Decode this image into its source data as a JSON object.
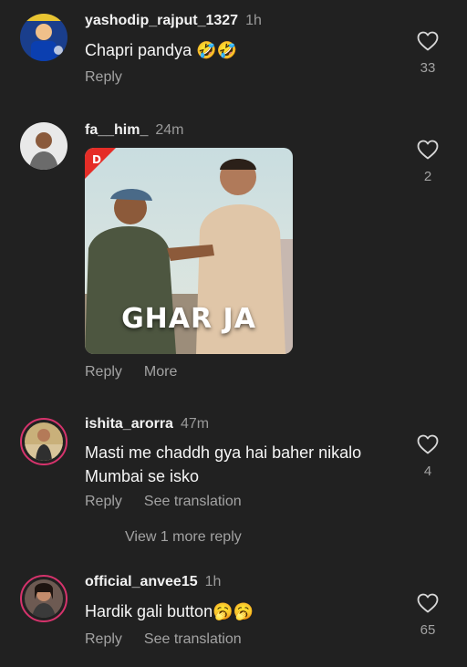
{
  "comments": [
    {
      "username": "yashodip_rajput_1327",
      "time": "1h",
      "text": "Chapri pandya 🤣🤣",
      "actions": [
        "Reply"
      ],
      "likes": "33",
      "avatar_icon": "user-avatar"
    },
    {
      "username": "fa__him_",
      "time": "24m",
      "gif_caption": "GHAR JA",
      "actions": [
        "Reply",
        "More"
      ],
      "likes": "2",
      "avatar_icon": "user-avatar"
    },
    {
      "username": "ishita_arorra",
      "time": "47m",
      "text": "Masti me chaddh gya hai baher nikalo Mumbai se isko",
      "actions": [
        "Reply",
        "See translation"
      ],
      "likes": "4",
      "avatar_icon": "user-avatar"
    },
    {
      "username": "official_anvee15",
      "time": "1h",
      "text": "Hardik gali button🥱🥱",
      "actions": [
        "Reply",
        "See translation"
      ],
      "likes": "65",
      "avatar_icon": "user-avatar"
    }
  ],
  "view_more_replies": "View 1 more reply",
  "colors": {
    "background": "#212121",
    "muted_text": "#a3a3a3",
    "story_ring": "#d6336c"
  }
}
